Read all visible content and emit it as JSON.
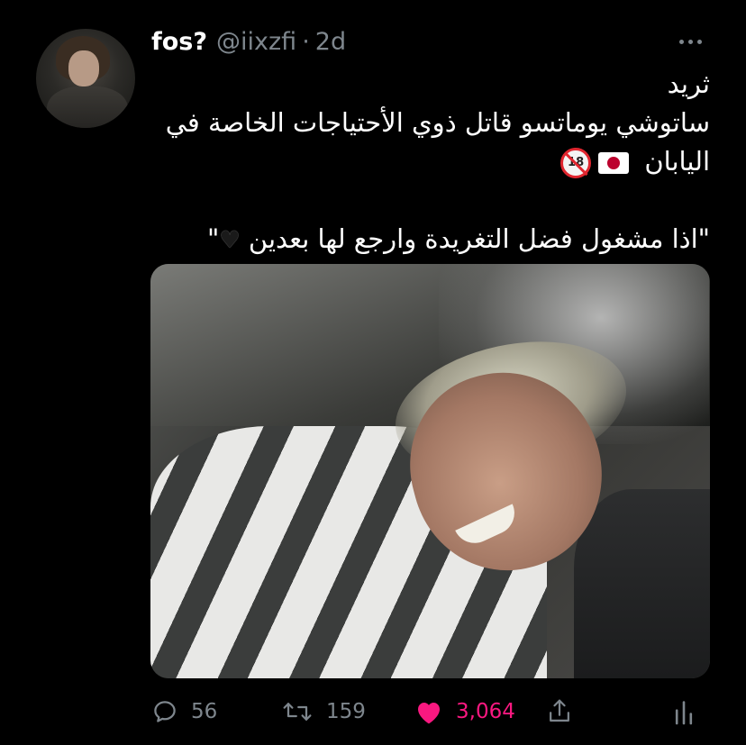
{
  "tweet": {
    "author_name": "fos?",
    "author_handle": "@iixzfi",
    "separator": "·",
    "time": "2d",
    "text_lines": [
      "ثريد",
      "ساتوشي يوماتسو قاتل ذوي الأحتياجات الخاصة في",
      "اليابان",
      "\"اذا مشغول فضل التغريدة وارجع لها بعدين"
    ],
    "quote_close": "\"",
    "no18_label": "18",
    "emoji_icons": [
      "japan-flag-icon",
      "no-under-18-icon",
      "black-heart-icon"
    ]
  },
  "actions": {
    "replies": "56",
    "retweets": "159",
    "likes": "3,064"
  },
  "colors": {
    "background": "#000000",
    "muted": "#7e868d",
    "like": "#f91880"
  }
}
